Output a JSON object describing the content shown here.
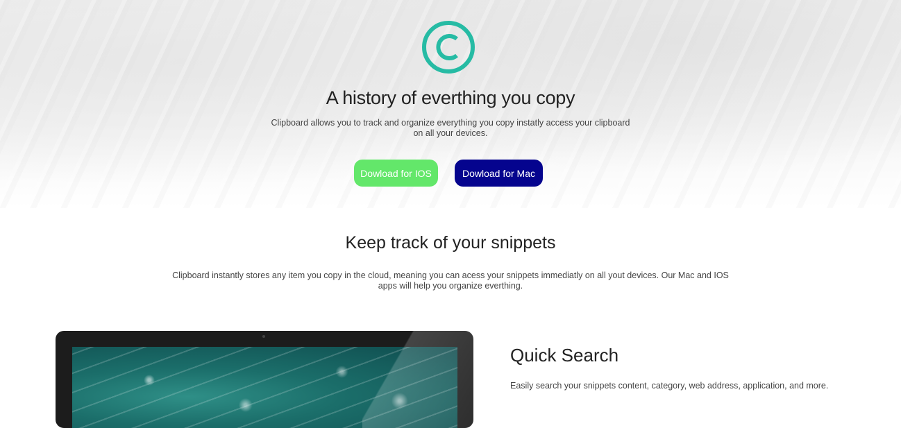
{
  "hero": {
    "logo_icon": "copyright-circle-icon",
    "title": "A history of everthing you copy",
    "description": "Clipboard allows you to track and organize everything you copy instatly access your clipboard on all your devices.",
    "buttons": {
      "ios_label": "Dowload for IOS",
      "mac_label": "Dowload for Mac"
    }
  },
  "snippets": {
    "title": "Keep track of your snippets",
    "description": "Clipboard instantly stores any item you copy in the cloud, meaning you can acess your snippets immediatly on all yout devices. Our Mac and IOS apps will help you organize everthing."
  },
  "feature": {
    "title": "Quick Search",
    "description": "Easily search your snippets content, category, web address, application, and more."
  },
  "colors": {
    "accent_teal": "#26bba4",
    "ios_button": "#63e76a",
    "mac_button": "#05048e"
  }
}
